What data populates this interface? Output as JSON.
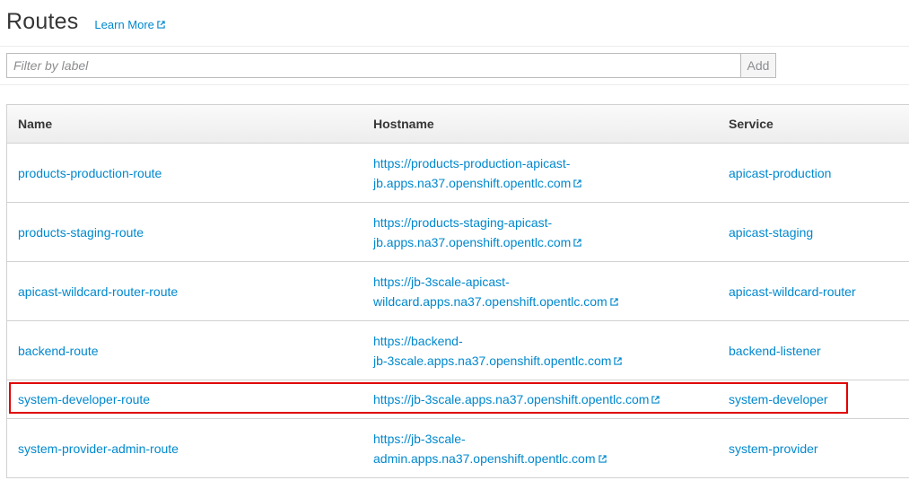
{
  "header": {
    "title": "Routes",
    "learn_more": "Learn More"
  },
  "filter": {
    "placeholder": "Filter by label",
    "value": "",
    "add_label": "Add"
  },
  "table": {
    "columns": [
      "Name",
      "Hostname",
      "Service"
    ],
    "rows": [
      {
        "name": "products-production-route",
        "host_line1": "https://products-production-apicast-",
        "host_line2": "jb.apps.na37.openshift.opentlc.com",
        "service": "apicast-production"
      },
      {
        "name": "products-staging-route",
        "host_line1": "https://products-staging-apicast-",
        "host_line2": "jb.apps.na37.openshift.opentlc.com",
        "service": "apicast-staging"
      },
      {
        "name": "apicast-wildcard-router-route",
        "host_line1": "https://jb-3scale-apicast-",
        "host_line2": "wildcard.apps.na37.openshift.opentlc.com",
        "service": "apicast-wildcard-router"
      },
      {
        "name": "backend-route",
        "host_line1": "https://backend-",
        "host_line2": "jb-3scale.apps.na37.openshift.opentlc.com",
        "service": "backend-listener"
      },
      {
        "name": "system-developer-route",
        "host_line1": "https://jb-3scale.apps.na37.openshift.opentlc.com",
        "host_line2": "",
        "service": "system-developer"
      },
      {
        "name": "system-provider-admin-route",
        "host_line1": "https://jb-3scale-",
        "host_line2": "admin.apps.na37.openshift.opentlc.com",
        "service": "system-provider"
      }
    ]
  },
  "colors": {
    "link": "#0088ce",
    "highlight": "#e00000"
  }
}
